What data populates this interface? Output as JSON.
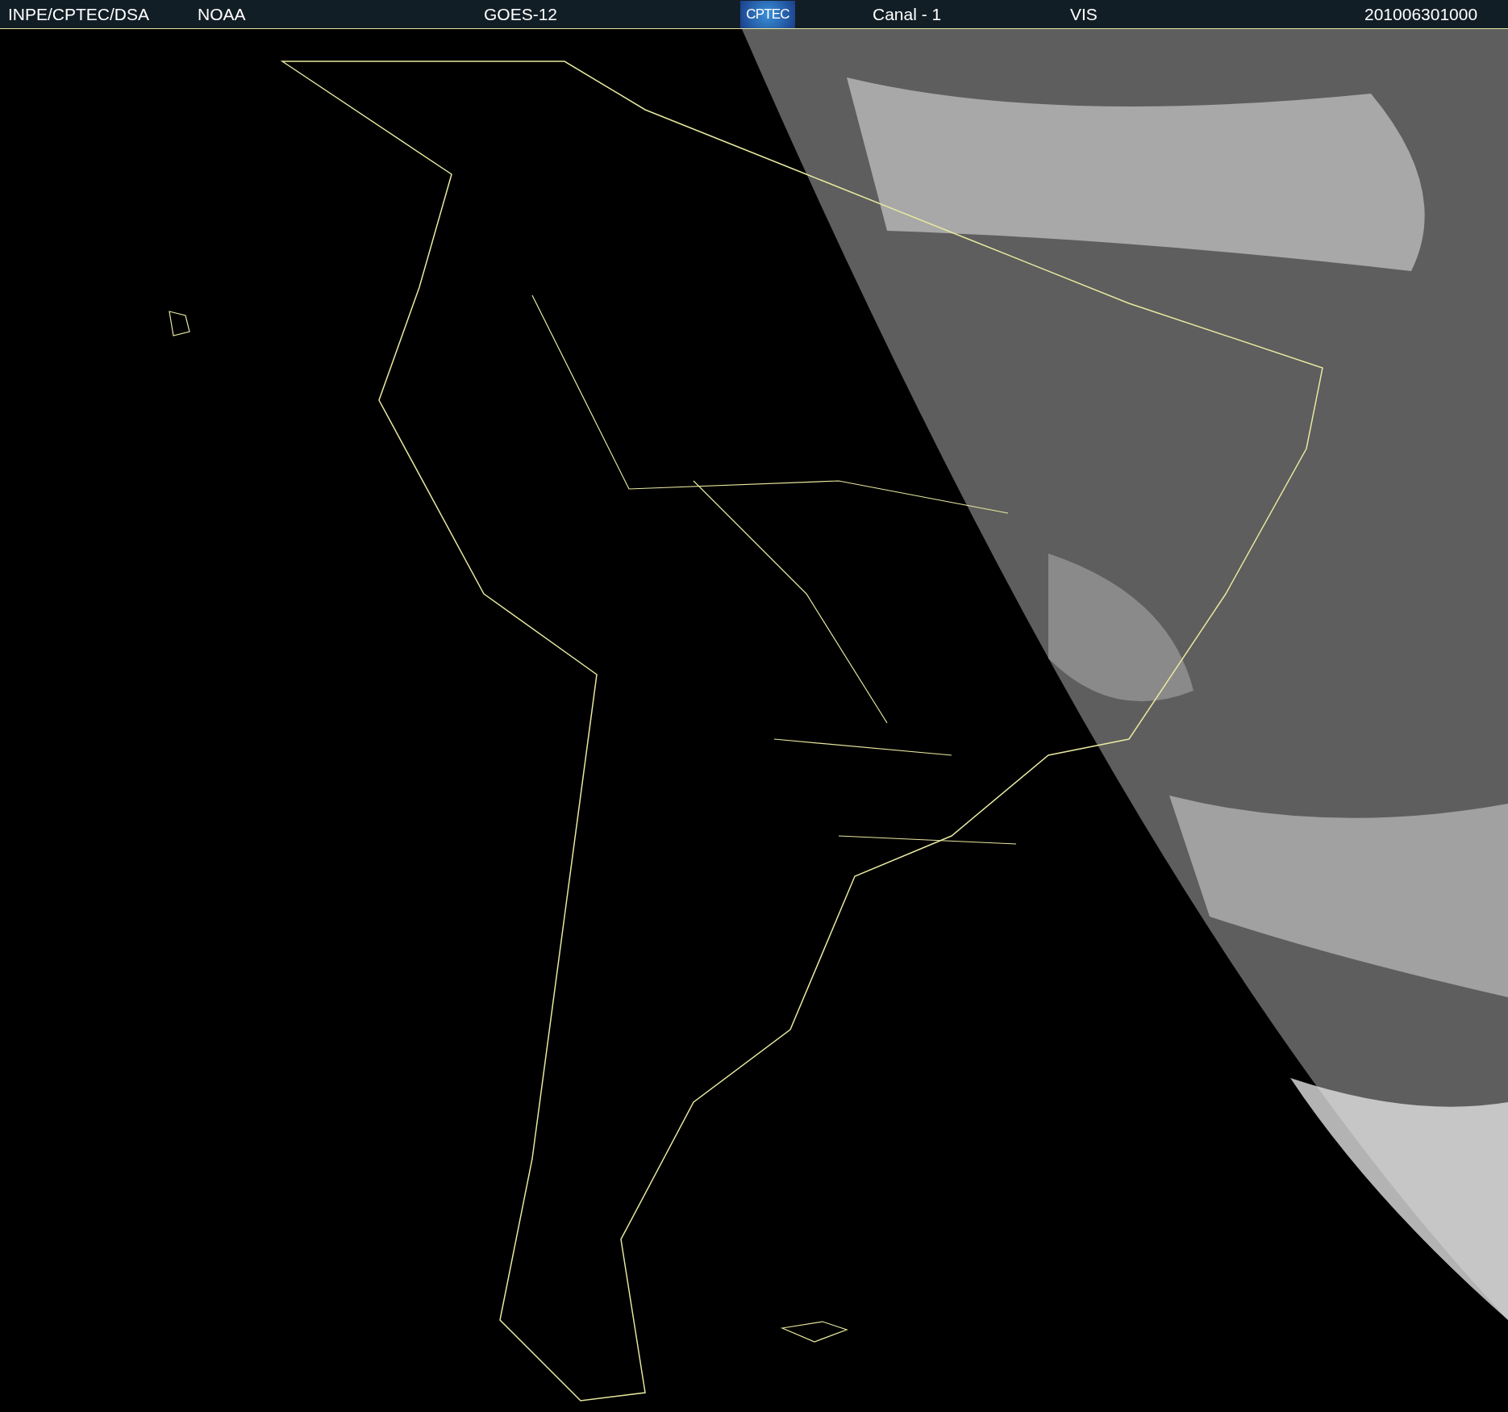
{
  "header": {
    "source": "INPE/CPTEC/DSA",
    "agency": "NOAA",
    "satellite": "GOES-12",
    "logo": "CPTEC",
    "channel": "Canal - 1",
    "band": "VIS",
    "timestamp": "201006301000"
  }
}
